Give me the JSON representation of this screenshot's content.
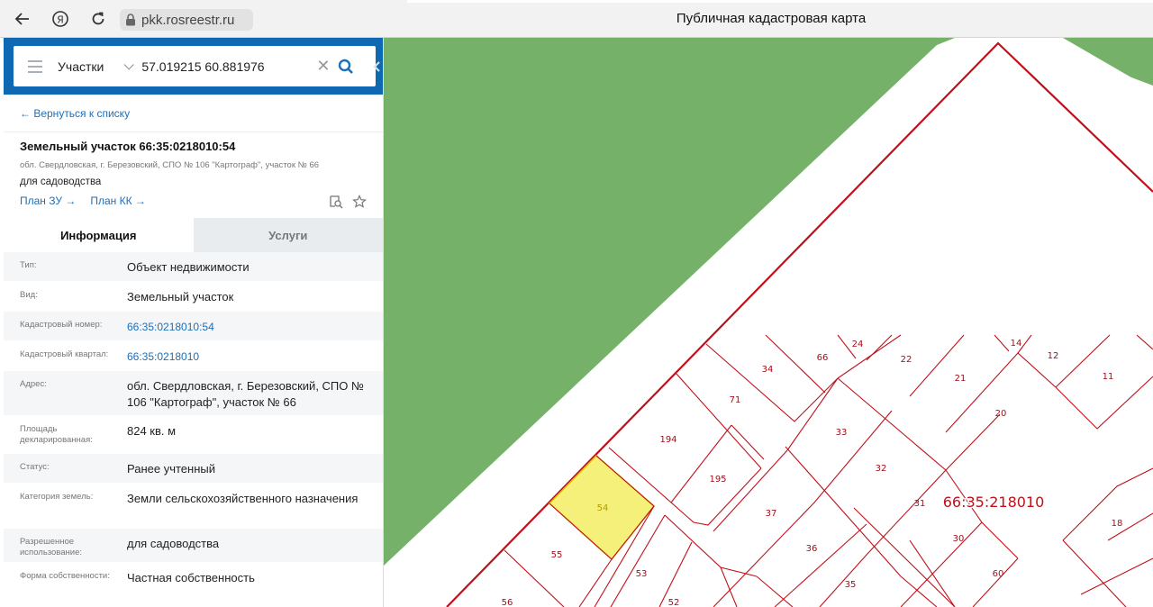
{
  "browser": {
    "url": "pkk.rosreestr.ru",
    "title": "Публичная кадастровая карта"
  },
  "search": {
    "type_select": "Участки",
    "query": "57.019215 60.881976"
  },
  "panel": {
    "back_link": "← Вернуться к списку",
    "object": {
      "title": "Земельный участок 66:35:0218010:54",
      "address": "обл. Свердловская, г. Березовский, СПО № 106 \"Картограф\", участок № 66",
      "use": "для садоводства",
      "plan_zu": "План ЗУ →",
      "plan_kk": "План КК →"
    },
    "tabs": [
      {
        "label": "Информация"
      },
      {
        "label": "Услуги"
      }
    ],
    "rows": [
      {
        "label": "Тип:",
        "value": "Объект недвижимости"
      },
      {
        "label": "Вид:",
        "value": "Земельный участок"
      },
      {
        "label": "Кадастровый номер:",
        "value": "66:35:0218010:54"
      },
      {
        "label": "Кадастровый квартал:",
        "value": "66:35:0218010"
      },
      {
        "label": "Адрес:",
        "value": "обл. Свердловская, г. Березовский, СПО № 106 \"Картограф\", участок № 66"
      },
      {
        "label": "Площадь декларированная:",
        "value": "824 кв. м"
      },
      {
        "label": "Статус:",
        "value": "Ранее учтенный"
      },
      {
        "label": "Категория земель:",
        "value": "Земли сельскохозяйственного назначения"
      },
      {
        "label": "Разрешенное использование:",
        "value": "для садоводства"
      },
      {
        "label": "Форма собственности:",
        "value": "Частная собственность"
      }
    ]
  },
  "map": {
    "quarter_label": "66:35:218010",
    "parcels": {
      "p54": "54",
      "p55": "55",
      "p56": "56",
      "p53": "53",
      "p52": "52",
      "p194": "194",
      "p195": "195",
      "p71": "71",
      "p34": "34",
      "p66": "66",
      "p24": "24",
      "p22": "22",
      "p21": "21",
      "p14": "14",
      "p12": "12",
      "p11": "11",
      "p20": "20",
      "p33": "33",
      "p32": "32",
      "p31": "31",
      "p37": "37",
      "p36": "36",
      "p35": "35",
      "p30": "30",
      "p60": "60",
      "p18": "18"
    },
    "colors": {
      "forest": "#76b169",
      "boundary": "#c0101a",
      "selected_fill": "#f5f07a",
      "selected_stroke": "#d8c400"
    }
  }
}
